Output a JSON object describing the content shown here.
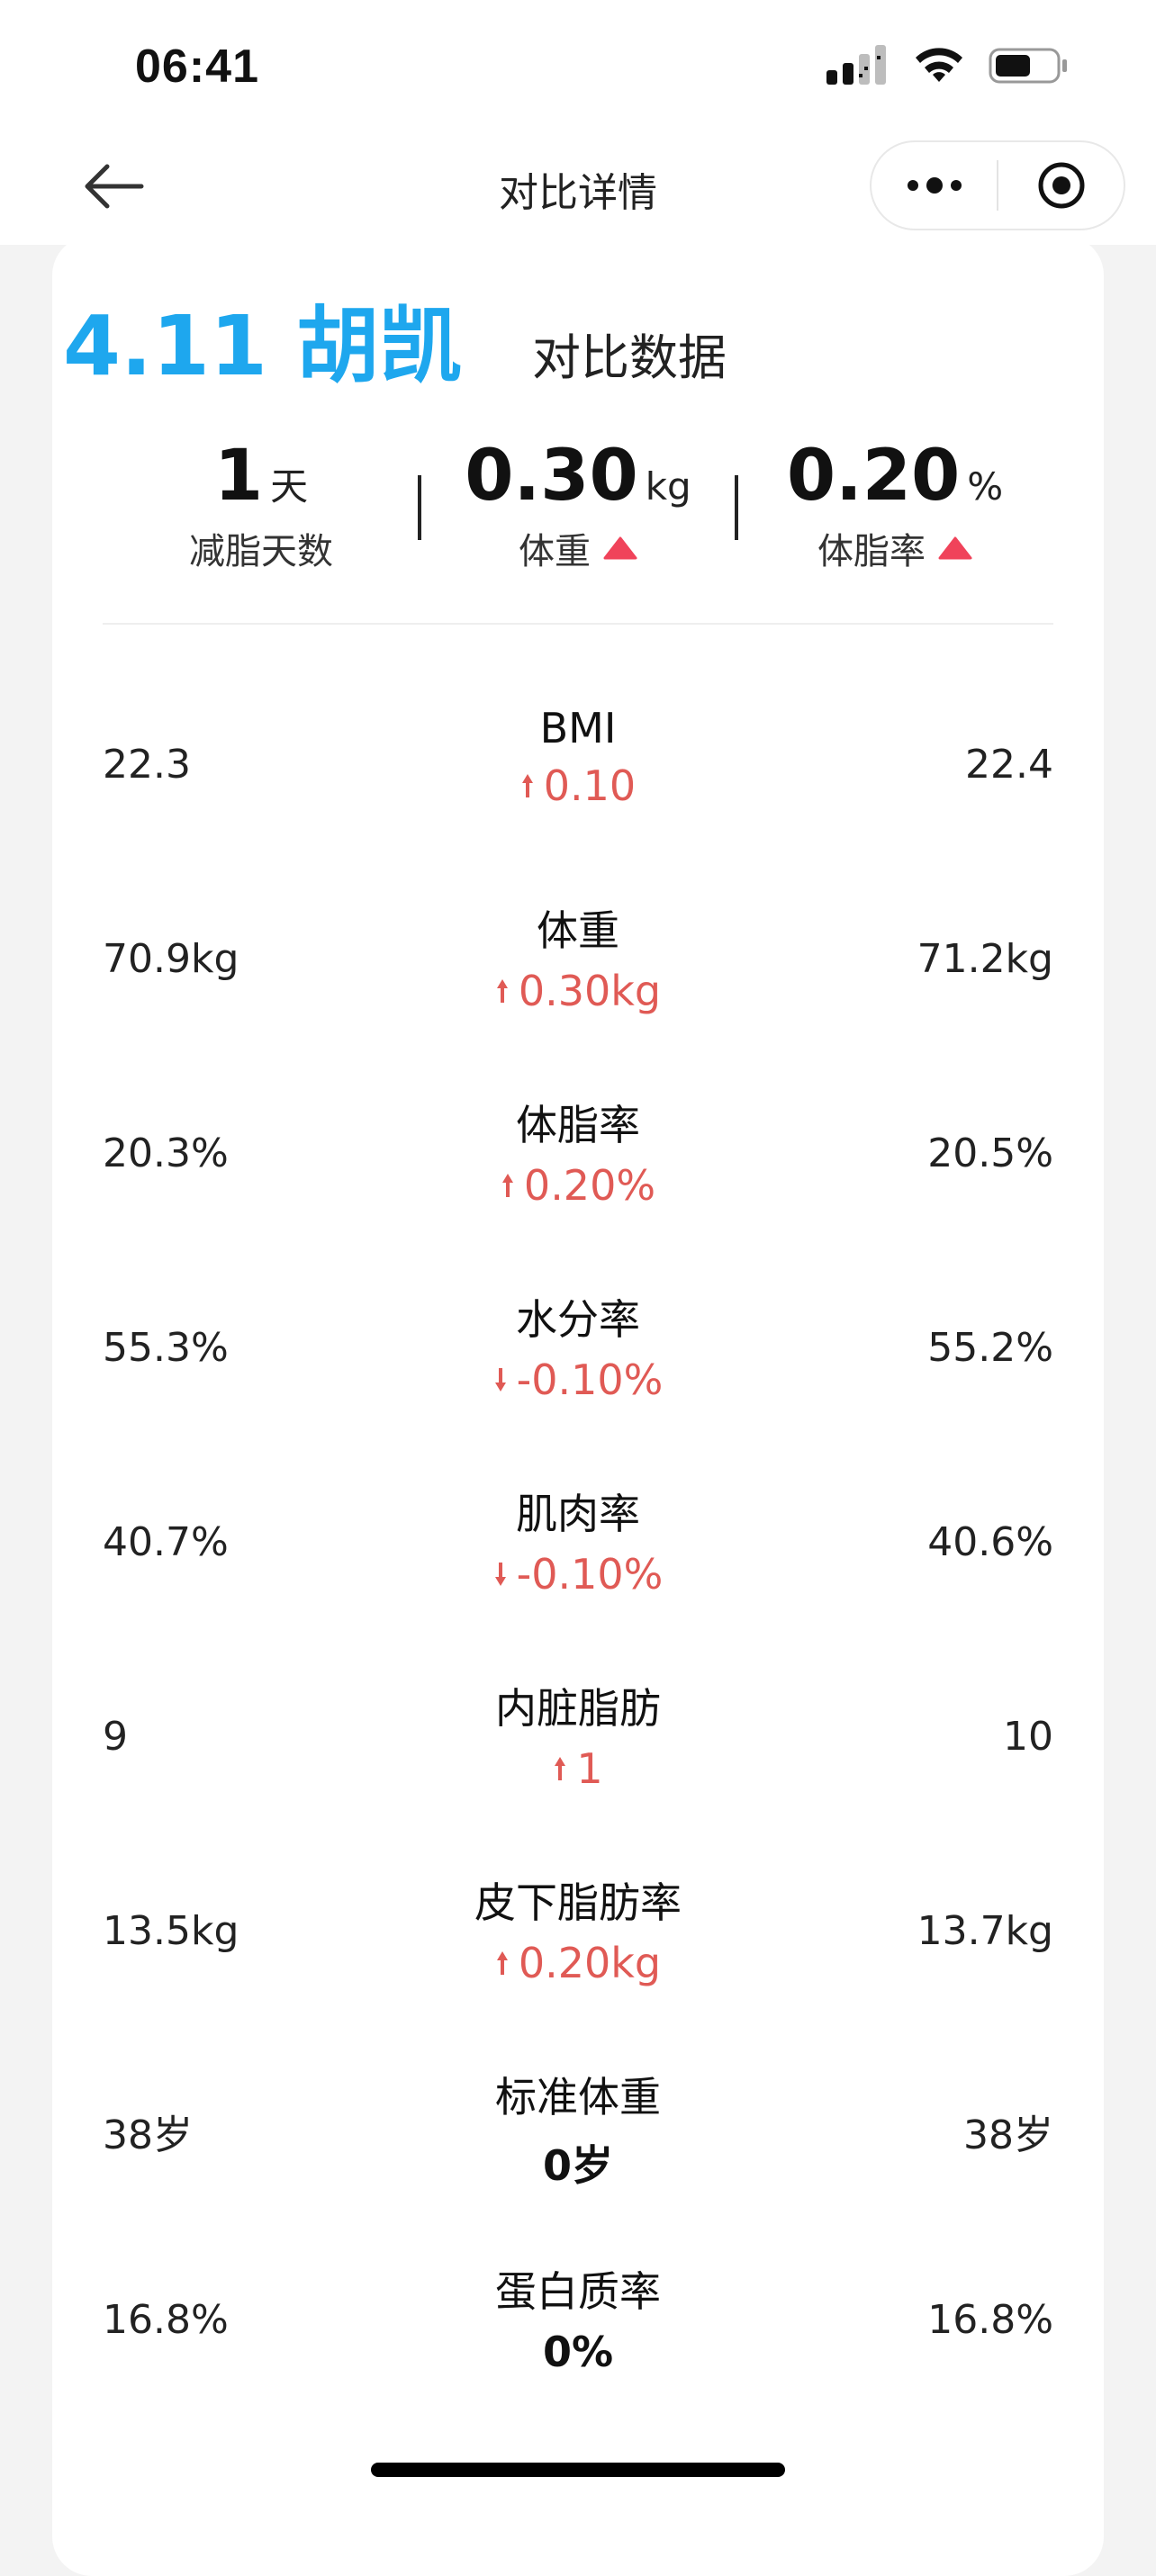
{
  "status_bar": {
    "time": "06:41"
  },
  "nav": {
    "title": "对比详情"
  },
  "header": {
    "title": "4.11 胡凯",
    "subtitle": "对比数据"
  },
  "summary": {
    "days": {
      "value": "1",
      "unit": "天",
      "label": "减脂天数"
    },
    "weight": {
      "value": "0.30",
      "unit": "kg",
      "label": "体重"
    },
    "body_fat": {
      "value": "0.20",
      "unit": "%",
      "label": "体脂率"
    }
  },
  "metrics": [
    {
      "name": "BMI",
      "left": "22.3",
      "right": "22.4",
      "delta": "0.10",
      "trend": "up"
    },
    {
      "name": "体重",
      "left": "70.9kg",
      "right": "71.2kg",
      "delta": "0.30kg",
      "trend": "up"
    },
    {
      "name": "体脂率",
      "left": "20.3%",
      "right": "20.5%",
      "delta": "0.20%",
      "trend": "up"
    },
    {
      "name": "水分率",
      "left": "55.3%",
      "right": "55.2%",
      "delta": "-0.10%",
      "trend": "down"
    },
    {
      "name": "肌肉率",
      "left": "40.7%",
      "right": "40.6%",
      "delta": "-0.10%",
      "trend": "down"
    },
    {
      "name": "内脏脂肪",
      "left": "9",
      "right": "10",
      "delta": "1",
      "trend": "up"
    },
    {
      "name": "皮下脂肪率",
      "left": "13.5kg",
      "right": "13.7kg",
      "delta": "0.20kg",
      "trend": "up"
    },
    {
      "name": "标准体重",
      "left": "38岁",
      "right": "38岁",
      "delta": "0岁",
      "trend": "none"
    },
    {
      "name": "蛋白质率",
      "left": "16.8%",
      "right": "16.8%",
      "delta": "0%",
      "trend": "none"
    }
  ],
  "colors": {
    "accent_blue": "#1ea7ee",
    "delta_red": "#e05a55",
    "triangle_red": "#f0435a"
  },
  "icons": {
    "back": "arrow-left-icon",
    "more": "more-dots-icon",
    "target": "target-icon",
    "trend_up": "arrow-up-icon",
    "trend_down": "arrow-down-icon"
  }
}
